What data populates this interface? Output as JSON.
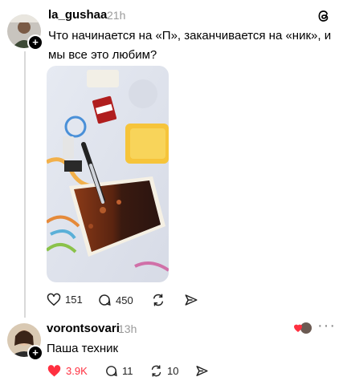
{
  "post": {
    "username": "la_gushaa",
    "time": "21h",
    "text_line1": "Что начинается на «П», заканчивается на «ник», и",
    "text_line2": "мы все это любим?",
    "likes": "151",
    "replies": "450",
    "app_icon": "threads-icon"
  },
  "reply": {
    "username": "vorontsovari",
    "time": "13h",
    "text": "Паша техник",
    "likes": "3.9K",
    "replies": "11",
    "reposts": "10",
    "like_color": "#ff3040"
  }
}
